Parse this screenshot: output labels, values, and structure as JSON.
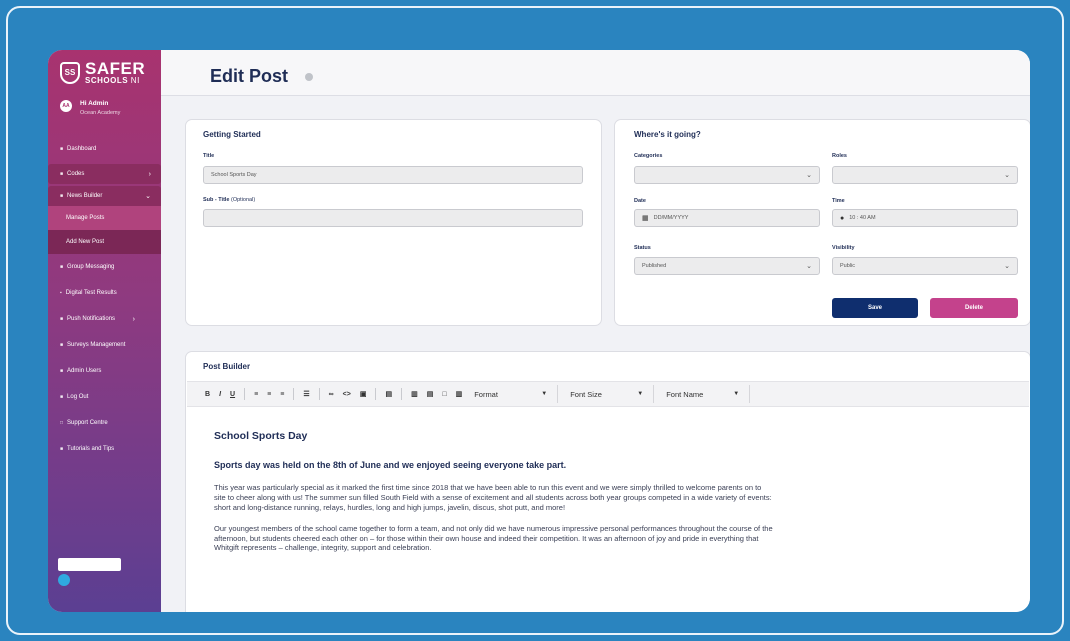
{
  "brand": {
    "name": "SAFER",
    "sub": "SCHOOLS",
    "region": "NI",
    "shield": "SS"
  },
  "user": {
    "greeting": "Hi Admin",
    "org": "Ocean Academy",
    "avatar": "AA"
  },
  "nav": {
    "dashboard": "Dashboard",
    "codes": "Codes",
    "news_builder": "News Builder",
    "manage_posts": "Manage Posts",
    "add_new_post": "Add New Post",
    "group_messaging": "Group Messaging",
    "digital_test_results": "Digital Test Results",
    "push_notifications": "Push Notifications",
    "surveys_management": "Surveys Management",
    "admin_users": "Admin Users",
    "log_out": "Log Out",
    "support_centre": "Support Centre",
    "tutorials_and_tips": "Tutorials and Tips"
  },
  "page": {
    "title": "Edit Post"
  },
  "getting_started": {
    "title": "Getting Started",
    "title_label": "Title",
    "title_value": "School Sports Day",
    "subtitle_label": "Sub - Title",
    "subtitle_optional": "(Optional)",
    "subtitle_value": ""
  },
  "where": {
    "title": "Where's it going?",
    "categories_label": "Categories",
    "categories_value": "",
    "roles_label": "Roles",
    "roles_value": "",
    "date_label": "Date",
    "date_placeholder": "DD/MM/YYYY",
    "time_label": "Time",
    "time_value": "10 : 40 AM",
    "status_label": "Status",
    "status_value": "Published",
    "visibility_label": "Visibility",
    "visibility_value": "Public",
    "save_label": "Save",
    "delete_label": "Delete"
  },
  "post_builder": {
    "title": "Post Builder",
    "toolbar": {
      "bold": "B",
      "italic": "I",
      "underline": "U",
      "format": "Format",
      "font_size": "Font Size",
      "font_name": "Font Name"
    },
    "content": {
      "heading": "School Sports Day",
      "subheading": "Sports day was held on the 8th of June and we enjoyed seeing everyone take part.",
      "para1": "This year was particularly special as it marked the first time since 2018 that we have been able to run this event and we were simply thrilled to welcome parents on to site to cheer along with us! The summer sun filled South Field with a sense of excitement and all students across both year groups competed in a wide variety of events: short and long-distance running, relays, hurdles, long and high jumps, javelin, discus, shot putt, and more!",
      "para2": "Our youngest members of the school came together to form a team, and not only did we have numerous impressive personal performances throughout the course of the afternoon, but students cheered each other on – for those within their own house and indeed their competition. It was an afternoon of joy and pride in everything that Whitgift represents – challenge, integrity, support and celebration."
    }
  },
  "colors": {
    "background": "#2a84bf",
    "navy": "#0f2e6e",
    "magenta": "#c4428c",
    "sidebar_top": "#a8336f",
    "sidebar_bottom": "#5b3f92"
  },
  "icons": [
    "shield-icon",
    "info-icon",
    "calendar-icon",
    "clock-icon",
    "chevron-down-icon",
    "chevron-right-icon",
    "chat-icon"
  ]
}
